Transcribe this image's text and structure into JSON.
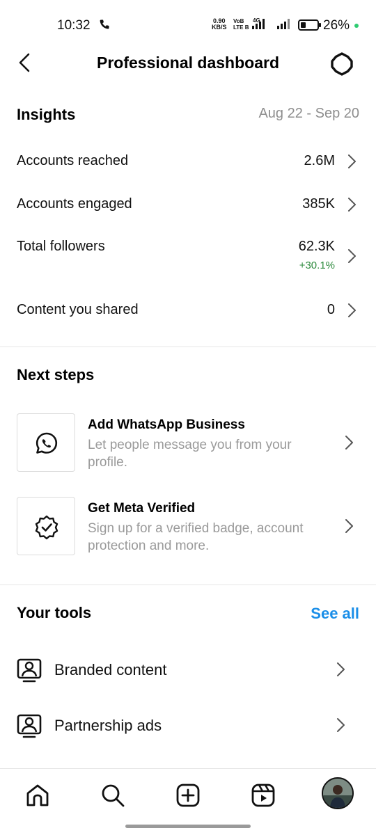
{
  "status_bar": {
    "time": "10:32",
    "net_speed_value": "0.90",
    "net_speed_unit": "KB/S",
    "volte_top": "VoB",
    "volte_bottom": "LTE B",
    "network_type": "4G",
    "battery_percent": "26%"
  },
  "header": {
    "title": "Professional dashboard"
  },
  "insights": {
    "title": "Insights",
    "date_range": "Aug 22 - Sep 20",
    "metrics": [
      {
        "label": "Accounts reached",
        "value": "2.6M"
      },
      {
        "label": "Accounts engaged",
        "value": "385K"
      },
      {
        "label": "Total followers",
        "value": "62.3K",
        "delta": "+30.1%"
      },
      {
        "label": "Content you shared",
        "value": "0"
      }
    ]
  },
  "next_steps": {
    "title": "Next steps",
    "items": [
      {
        "title": "Add WhatsApp Business",
        "description": "Let people message you from your profile.",
        "icon": "whatsapp-icon"
      },
      {
        "title": "Get Meta Verified",
        "description": "Sign up for a verified badge, account protection and more.",
        "icon": "verified-badge-icon"
      }
    ]
  },
  "tools": {
    "title": "Your tools",
    "see_all": "See all",
    "items": [
      {
        "label": "Branded content",
        "icon": "branded-content-icon"
      },
      {
        "label": "Partnership ads",
        "icon": "partnership-ads-icon"
      }
    ]
  },
  "bottom_nav": {
    "items": [
      "home-icon",
      "search-icon",
      "create-icon",
      "reels-icon",
      "profile-avatar"
    ]
  },
  "colors": {
    "accent": "#1a8ee8",
    "positive": "#2e8b3e",
    "muted_text": "#8e8e8e",
    "divider": "#e6e6e6"
  }
}
